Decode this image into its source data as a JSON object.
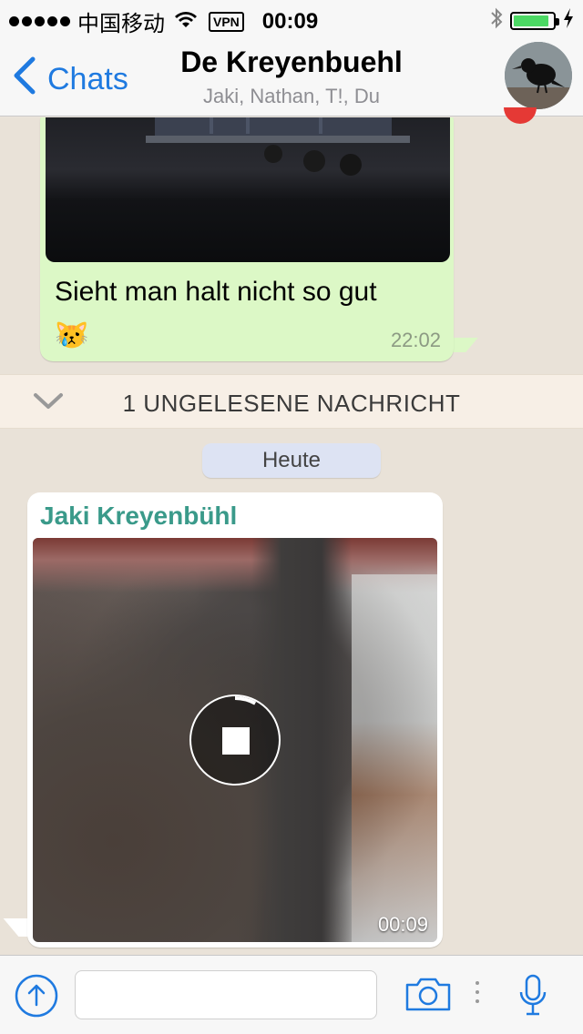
{
  "status_bar": {
    "carrier": "中国移动",
    "vpn": "VPN",
    "time": "00:09",
    "battery_level": 0.9
  },
  "header": {
    "back_label": "Chats",
    "title": "De Kreyenbuehl",
    "subtitle": "Jaki, Nathan, T!, Du"
  },
  "messages": {
    "outgoing": {
      "text": "Sieht man halt nicht so gut😿",
      "time": "22:02"
    },
    "unread_banner": "1 UNGELESENE NACHRICHT",
    "date_separator": "Heute",
    "incoming": {
      "sender": "Jaki Kreyenbühl",
      "video_duration": "00:09",
      "download_progress": 0.08
    }
  },
  "input": {
    "placeholder": "",
    "value": ""
  },
  "colors": {
    "accent": "#1f7ae0",
    "outgoing_bubble": "#dcf8c6",
    "sender_name": "#3a9a8a"
  }
}
